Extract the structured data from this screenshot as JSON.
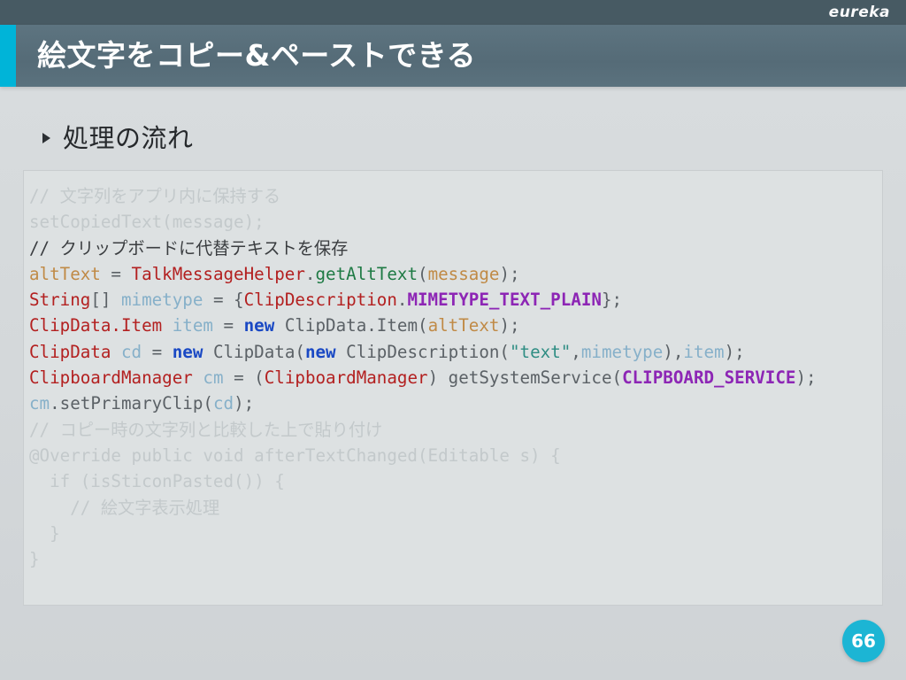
{
  "topbar": {
    "brand": "eureka"
  },
  "header": {
    "title": "絵文字をコピー&ペーストできる",
    "accent_color": "#00b4d8",
    "band_color": "#556b77"
  },
  "section": {
    "bullet_icon": "triangle-right-icon",
    "title": "処理の流れ"
  },
  "code_block": {
    "language": "java",
    "lines": [
      {
        "id": "line-1",
        "dim": true,
        "tokens": [
          {
            "text": "// 文字列をアプリ内に保持する",
            "cls": "t-dim"
          }
        ]
      },
      {
        "id": "line-2",
        "dim": true,
        "tokens": [
          {
            "text": "setCopiedText(message);",
            "cls": "t-dim"
          }
        ]
      },
      {
        "id": "line-3",
        "dim": false,
        "tokens": [
          {
            "text": "// クリップボードに代替テキストを保存",
            "cls": "t-cmt"
          }
        ]
      },
      {
        "id": "line-4",
        "dim": false,
        "tokens": [
          {
            "text": "altText",
            "cls": "t-param"
          },
          {
            "text": " = ",
            "cls": "t-plain"
          },
          {
            "text": "TalkMessageHelper",
            "cls": "t-type"
          },
          {
            "text": ".",
            "cls": "t-plain"
          },
          {
            "text": "getAltText",
            "cls": "t-meth"
          },
          {
            "text": "(",
            "cls": "t-plain"
          },
          {
            "text": "message",
            "cls": "t-param"
          },
          {
            "text": ");",
            "cls": "t-plain"
          }
        ]
      },
      {
        "id": "line-5",
        "dim": false,
        "tokens": [
          {
            "text": "String",
            "cls": "t-type"
          },
          {
            "text": "[] ",
            "cls": "t-plain"
          },
          {
            "text": "mimetype",
            "cls": "t-var"
          },
          {
            "text": " = {",
            "cls": "t-plain"
          },
          {
            "text": "ClipDescription",
            "cls": "t-type"
          },
          {
            "text": ".",
            "cls": "t-plain"
          },
          {
            "text": "MIMETYPE_TEXT_PLAIN",
            "cls": "t-const"
          },
          {
            "text": "};",
            "cls": "t-plain"
          }
        ]
      },
      {
        "id": "line-6",
        "dim": false,
        "tokens": [
          {
            "text": "ClipData.Item",
            "cls": "t-type"
          },
          {
            "text": " ",
            "cls": "t-plain"
          },
          {
            "text": "item",
            "cls": "t-var"
          },
          {
            "text": " = ",
            "cls": "t-plain"
          },
          {
            "text": "new",
            "cls": "t-kw"
          },
          {
            "text": " ClipData.Item(",
            "cls": "t-plain"
          },
          {
            "text": "altText",
            "cls": "t-param"
          },
          {
            "text": ");",
            "cls": "t-plain"
          }
        ]
      },
      {
        "id": "line-7",
        "dim": false,
        "tokens": [
          {
            "text": "ClipData",
            "cls": "t-type"
          },
          {
            "text": " ",
            "cls": "t-plain"
          },
          {
            "text": "cd",
            "cls": "t-var"
          },
          {
            "text": " = ",
            "cls": "t-plain"
          },
          {
            "text": "new",
            "cls": "t-kw"
          },
          {
            "text": " ClipData(",
            "cls": "t-plain"
          },
          {
            "text": "new",
            "cls": "t-kw"
          },
          {
            "text": " ClipDescription(",
            "cls": "t-plain"
          },
          {
            "text": "\"text\"",
            "cls": "t-str"
          },
          {
            "text": ",",
            "cls": "t-plain"
          },
          {
            "text": "mimetype",
            "cls": "t-var"
          },
          {
            "text": "),",
            "cls": "t-plain"
          },
          {
            "text": "item",
            "cls": "t-var"
          },
          {
            "text": ");",
            "cls": "t-plain"
          }
        ]
      },
      {
        "id": "line-8",
        "dim": false,
        "tokens": [
          {
            "text": "ClipboardManager",
            "cls": "t-type"
          },
          {
            "text": " ",
            "cls": "t-plain"
          },
          {
            "text": "cm",
            "cls": "t-var"
          },
          {
            "text": " = (",
            "cls": "t-plain"
          },
          {
            "text": "ClipboardManager",
            "cls": "t-type"
          },
          {
            "text": ") getSystemService(",
            "cls": "t-plain"
          },
          {
            "text": "CLIPBOARD_SERVICE",
            "cls": "t-const"
          },
          {
            "text": ");",
            "cls": "t-plain"
          }
        ]
      },
      {
        "id": "line-9",
        "dim": false,
        "tokens": [
          {
            "text": "cm",
            "cls": "t-var"
          },
          {
            "text": ".setPrimaryClip(",
            "cls": "t-plain"
          },
          {
            "text": "cd",
            "cls": "t-var"
          },
          {
            "text": ");",
            "cls": "t-plain"
          }
        ]
      },
      {
        "id": "line-10",
        "dim": true,
        "tokens": [
          {
            "text": "// コピー時の文字列と比較した上で貼り付け",
            "cls": "t-dim"
          }
        ]
      },
      {
        "id": "line-11",
        "dim": true,
        "tokens": [
          {
            "text": "@Override public void afterTextChanged(Editable s) {",
            "cls": "t-dim"
          }
        ]
      },
      {
        "id": "line-12",
        "dim": true,
        "tokens": [
          {
            "text": "  if (isSticonPasted()) {",
            "cls": "t-dim"
          }
        ]
      },
      {
        "id": "line-13",
        "dim": true,
        "tokens": [
          {
            "text": "    // 絵文字表示処理",
            "cls": "t-dim"
          }
        ]
      },
      {
        "id": "line-14",
        "dim": true,
        "tokens": [
          {
            "text": "  }",
            "cls": "t-dim"
          }
        ]
      },
      {
        "id": "line-15",
        "dim": true,
        "tokens": [
          {
            "text": "}",
            "cls": "t-dim"
          }
        ]
      }
    ]
  },
  "footer": {
    "page_number": "66",
    "badge_color": "#1cb5d4"
  }
}
